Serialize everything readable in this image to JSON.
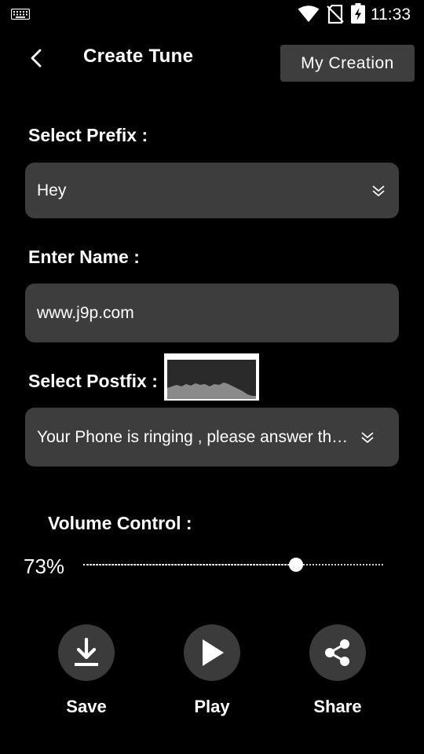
{
  "status_bar": {
    "time": "11:33",
    "icons": [
      "keyboard-icon",
      "wifi-icon",
      "no-sim-icon",
      "battery-charging-icon"
    ]
  },
  "header": {
    "back_icon": "chevron-left-icon",
    "title": "Create Tune",
    "my_creation_label": "My Creation"
  },
  "prefix": {
    "label": "Select Prefix :",
    "selected": "Hey",
    "icon": "double-chevron-down-icon"
  },
  "name": {
    "label": "Enter Name :",
    "value": "www.j9p.com"
  },
  "postfix": {
    "label": "Select Postfix :",
    "selected": "Your Phone is ringing , please answer the call",
    "icon": "double-chevron-down-icon"
  },
  "volume": {
    "label": "Volume Control :",
    "percent_text": "73%",
    "value": 0.71
  },
  "actions": [
    {
      "label": "Save",
      "icon": "download-icon"
    },
    {
      "label": "Play",
      "icon": "play-icon"
    },
    {
      "label": "Share",
      "icon": "share-icon"
    }
  ],
  "colors": {
    "background": "#000000",
    "surface": "#3d3d3d",
    "text": "#ffffff"
  }
}
